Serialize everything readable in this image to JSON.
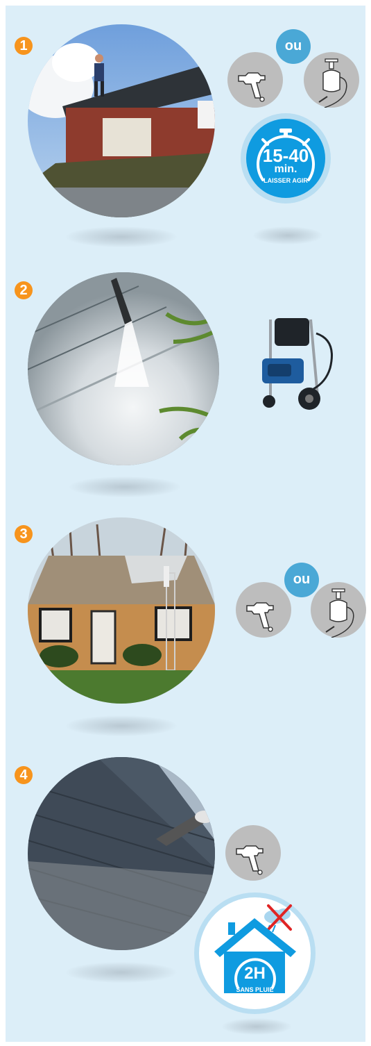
{
  "steps": [
    {
      "number": "1"
    },
    {
      "number": "2"
    },
    {
      "number": "3"
    },
    {
      "number": "4"
    }
  ],
  "labels": {
    "or": "ou",
    "timer_range": "15-40",
    "timer_unit": "min.",
    "timer_caption": "LAISSER AGIR",
    "rain_hours": "2H",
    "rain_caption": "SANS PLUIE"
  },
  "icons": {
    "step1_tool_a": "spray-gun-icon",
    "step1_tool_b": "pressure-sprayer-icon",
    "step1_badge": "stopwatch-icon",
    "step2_tool": "pressure-washer-icon",
    "step3_tool_a": "spray-gun-icon",
    "step3_tool_b": "pressure-sprayer-icon",
    "step4_tool": "spray-gun-icon",
    "step4_badge": "house-no-rain-icon"
  },
  "colors": {
    "background": "#dceef8",
    "step_number": "#f7941d",
    "accent_blue": "#0f9be0",
    "tool_grey": "#bdbdbd"
  }
}
